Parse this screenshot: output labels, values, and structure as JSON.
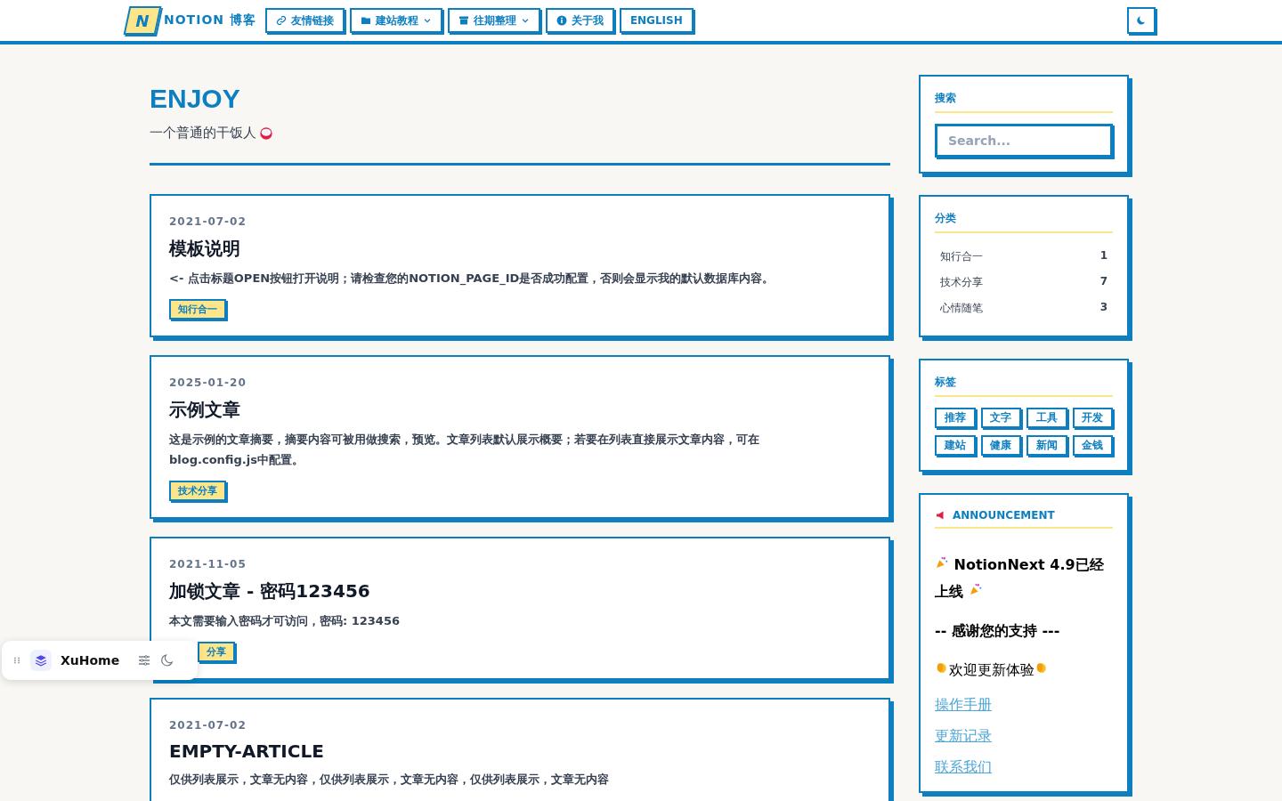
{
  "header": {
    "logo_letter": "N",
    "logo_text": "NOTION 博客",
    "menu": [
      {
        "label": "友情链接",
        "dropdown": false
      },
      {
        "label": "建站教程",
        "dropdown": true
      },
      {
        "label": "往期整理",
        "dropdown": true
      },
      {
        "label": "关于我",
        "dropdown": false
      },
      {
        "label": "ENGLISH",
        "dropdown": false
      }
    ]
  },
  "hero": {
    "title": "ENJOY",
    "subtitle": "一个普通的干饭人"
  },
  "posts": [
    {
      "date": "2021-07-02",
      "title": "模板说明",
      "excerpt": "<- 点击标题OPEN按钮打开说明；请检查您的NOTION_PAGE_ID是否成功配置，否则会显示我的默认数据库内容。",
      "tag": "知行合一"
    },
    {
      "date": "2025-01-20",
      "title": "示例文章",
      "excerpt": "这是示例的文章摘要，摘要内容可被用做搜索，预览。文章列表默认展示概要；若要在列表直接展示文章内容，可在blog.config.js中配置。",
      "tag": "技术分享"
    },
    {
      "date": "2021-11-05",
      "title": "加锁文章 - 密码123456",
      "excerpt": "本文需要输入密码才可访问，密码: 123456",
      "tag": "分享",
      "tag_covered": true
    },
    {
      "date": "2021-07-02",
      "title": "EMPTY-ARTICLE",
      "excerpt": "仅供列表展示，文章无内容，仅供列表展示，文章无内容，仅供列表展示，文章无内容"
    }
  ],
  "sidebar": {
    "search": {
      "title": "搜索",
      "placeholder": "Search..."
    },
    "categories": {
      "title": "分类",
      "items": [
        {
          "name": "知行合一",
          "count": "1"
        },
        {
          "name": "技术分享",
          "count": "7"
        },
        {
          "name": "心情随笔",
          "count": "3"
        }
      ]
    },
    "tags": {
      "title": "标签",
      "items": [
        "推荐",
        "文字",
        "工具",
        "开发",
        "建站",
        "健康",
        "新闻",
        "金钱"
      ]
    },
    "announcement": {
      "title": "ANNOUNCEMENT",
      "lines": [
        {
          "kind": "headline",
          "text": "NotionNext 4.9已经上线"
        },
        {
          "kind": "bold",
          "text": "-- 感谢您的支持 ---"
        },
        {
          "kind": "clap",
          "text": "欢迎更新体验"
        },
        {
          "kind": "link",
          "text": "操作手册"
        },
        {
          "kind": "link",
          "text": "更新记录"
        },
        {
          "kind": "link",
          "text": "联系我们"
        }
      ]
    }
  },
  "floating_bar": {
    "label": "XuHome"
  }
}
